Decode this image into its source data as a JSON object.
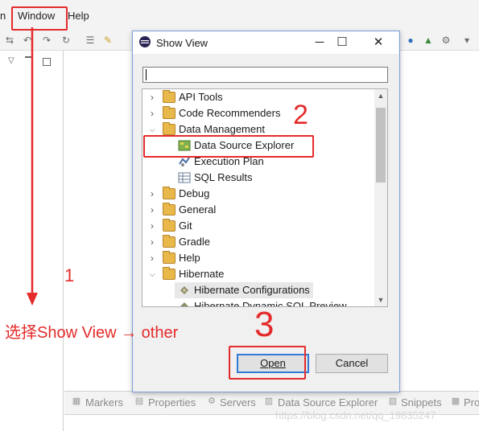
{
  "menubar": {
    "partial_left": "n",
    "window": "Window",
    "help": "Help"
  },
  "dialog": {
    "title": "Show View",
    "minimize_icon": "minimize-icon",
    "maximize_icon": "maximize-icon",
    "close_icon": "close-icon",
    "filter_value": "",
    "tree": [
      {
        "label": "API Tools",
        "expanded": false,
        "icon": "folder-icon"
      },
      {
        "label": "Code Recommenders",
        "expanded": false,
        "icon": "folder-icon"
      },
      {
        "label": "Data Management",
        "expanded": true,
        "icon": "folder-icon"
      },
      {
        "label": "Data Source Explorer",
        "icon": "data-source-explorer-icon"
      },
      {
        "label": "Execution Plan",
        "icon": "execution-plan-icon"
      },
      {
        "label": "SQL Results",
        "icon": "sql-results-icon"
      },
      {
        "label": "Debug",
        "expanded": false,
        "icon": "folder-icon"
      },
      {
        "label": "General",
        "expanded": false,
        "icon": "folder-icon"
      },
      {
        "label": "Git",
        "expanded": false,
        "icon": "folder-icon"
      },
      {
        "label": "Gradle",
        "expanded": false,
        "icon": "folder-icon"
      },
      {
        "label": "Help",
        "expanded": false,
        "icon": "folder-icon"
      },
      {
        "label": "Hibernate",
        "expanded": true,
        "icon": "folder-icon"
      },
      {
        "label": "Hibernate Configurations",
        "icon": "hibernate-icon",
        "selected": true
      },
      {
        "label": "Hibernate Dynamic SQL Preview",
        "icon": "hibernate-icon"
      }
    ],
    "open_button": "Open",
    "cancel_button": "Cancel"
  },
  "bottom_tabs": [
    "Markers",
    "Properties",
    "Servers",
    "Data Source Explorer",
    "Snippets",
    "Pro"
  ],
  "annotations": {
    "step1": "1",
    "step2": "2",
    "step3": "3",
    "instruction": "选择Show View → other",
    "color": "#e52b2b"
  },
  "watermark": "https://blog.csdn.net/qq_19835247"
}
